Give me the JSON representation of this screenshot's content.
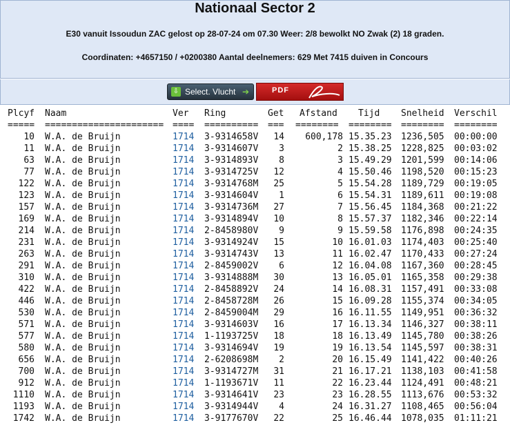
{
  "header": {
    "title": "Nationaal Sector 2",
    "line1": "E30 vanuit Issoudun ZAC gelost op 28-07-24 om 07.30 Weer: 2/8 bewolkt NO Zwak (2) 18 graden.",
    "line2": "Coordinaten: +4657150 / +0200380 Aantal deelnemers: 629 Met 7415 duiven in Concours"
  },
  "buttons": {
    "select_label": "Select. Vlucht",
    "pdf_label": "PDF"
  },
  "table": {
    "columns": [
      "Plcyf",
      "Naam",
      "Ver",
      "Ring",
      "Get",
      "Afstand",
      "Tijd",
      "Snelheid",
      "Verschil"
    ],
    "separators": [
      "=====",
      "======================",
      "====",
      "==========",
      "===",
      "========",
      "========",
      "========",
      "========"
    ],
    "rows": [
      [
        "10",
        "W.A. de Bruijn",
        "1714",
        "3-9314658V",
        "14",
        "600,178",
        "15.35.23",
        "1236,505",
        "00:00:00"
      ],
      [
        "11",
        "W.A. de Bruijn",
        "1714",
        "3-9314607V",
        "3",
        "2",
        "15.38.25",
        "1228,825",
        "00:03:02"
      ],
      [
        "63",
        "W.A. de Bruijn",
        "1714",
        "3-9314893V",
        "8",
        "3",
        "15.49.29",
        "1201,599",
        "00:14:06"
      ],
      [
        "77",
        "W.A. de Bruijn",
        "1714",
        "3-9314725V",
        "12",
        "4",
        "15.50.46",
        "1198,520",
        "00:15:23"
      ],
      [
        "122",
        "W.A. de Bruijn",
        "1714",
        "3-9314768M",
        "25",
        "5",
        "15.54.28",
        "1189,729",
        "00:19:05"
      ],
      [
        "123",
        "W.A. de Bruijn",
        "1714",
        "3-9314604V",
        "1",
        "6",
        "15.54.31",
        "1189,611",
        "00:19:08"
      ],
      [
        "157",
        "W.A. de Bruijn",
        "1714",
        "3-9314736M",
        "27",
        "7",
        "15.56.45",
        "1184,368",
        "00:21:22"
      ],
      [
        "169",
        "W.A. de Bruijn",
        "1714",
        "3-9314894V",
        "10",
        "8",
        "15.57.37",
        "1182,346",
        "00:22:14"
      ],
      [
        "214",
        "W.A. de Bruijn",
        "1714",
        "2-8458980V",
        "9",
        "9",
        "15.59.58",
        "1176,898",
        "00:24:35"
      ],
      [
        "231",
        "W.A. de Bruijn",
        "1714",
        "3-9314924V",
        "15",
        "10",
        "16.01.03",
        "1174,403",
        "00:25:40"
      ],
      [
        "263",
        "W.A. de Bruijn",
        "1714",
        "3-9314743V",
        "13",
        "11",
        "16.02.47",
        "1170,433",
        "00:27:24"
      ],
      [
        "291",
        "W.A. de Bruijn",
        "1714",
        "2-8459002V",
        "6",
        "12",
        "16.04.08",
        "1167,360",
        "00:28:45"
      ],
      [
        "310",
        "W.A. de Bruijn",
        "1714",
        "3-9314888M",
        "30",
        "13",
        "16.05.01",
        "1165,358",
        "00:29:38"
      ],
      [
        "422",
        "W.A. de Bruijn",
        "1714",
        "2-8458892V",
        "24",
        "14",
        "16.08.31",
        "1157,491",
        "00:33:08"
      ],
      [
        "446",
        "W.A. de Bruijn",
        "1714",
        "2-8458728M",
        "26",
        "15",
        "16.09.28",
        "1155,374",
        "00:34:05"
      ],
      [
        "530",
        "W.A. de Bruijn",
        "1714",
        "2-8459004M",
        "29",
        "16",
        "16.11.55",
        "1149,951",
        "00:36:32"
      ],
      [
        "571",
        "W.A. de Bruijn",
        "1714",
        "3-9314603V",
        "16",
        "17",
        "16.13.34",
        "1146,327",
        "00:38:11"
      ],
      [
        "577",
        "W.A. de Bruijn",
        "1714",
        "1-1193725V",
        "18",
        "18",
        "16.13.49",
        "1145,780",
        "00:38:26"
      ],
      [
        "580",
        "W.A. de Bruijn",
        "1714",
        "3-9314694V",
        "19",
        "19",
        "16.13.54",
        "1145,597",
        "00:38:31"
      ],
      [
        "656",
        "W.A. de Bruijn",
        "1714",
        "2-6208698M",
        "2",
        "20",
        "16.15.49",
        "1141,422",
        "00:40:26"
      ],
      [
        "700",
        "W.A. de Bruijn",
        "1714",
        "3-9314727M",
        "31",
        "21",
        "16.17.21",
        "1138,103",
        "00:41:58"
      ],
      [
        "912",
        "W.A. de Bruijn",
        "1714",
        "1-1193671V",
        "11",
        "22",
        "16.23.44",
        "1124,491",
        "00:48:21"
      ],
      [
        "1110",
        "W.A. de Bruijn",
        "1714",
        "3-9314641V",
        "23",
        "23",
        "16.28.55",
        "1113,676",
        "00:53:32"
      ],
      [
        "1193",
        "W.A. de Bruijn",
        "1714",
        "3-9314944V",
        "4",
        "24",
        "16.31.27",
        "1108,465",
        "00:56:04"
      ],
      [
        "1742",
        "W.A. de Bruijn",
        "1714",
        "3-9177670V",
        "22",
        "25",
        "16.46.44",
        "1078,035",
        "01:11:21"
      ]
    ]
  },
  "colors": {
    "header_bg": "#dfe8f6",
    "header_border": "#9fb3d1",
    "ver_link": "#1f5fa0",
    "pdf_red": "#c41e1e"
  }
}
